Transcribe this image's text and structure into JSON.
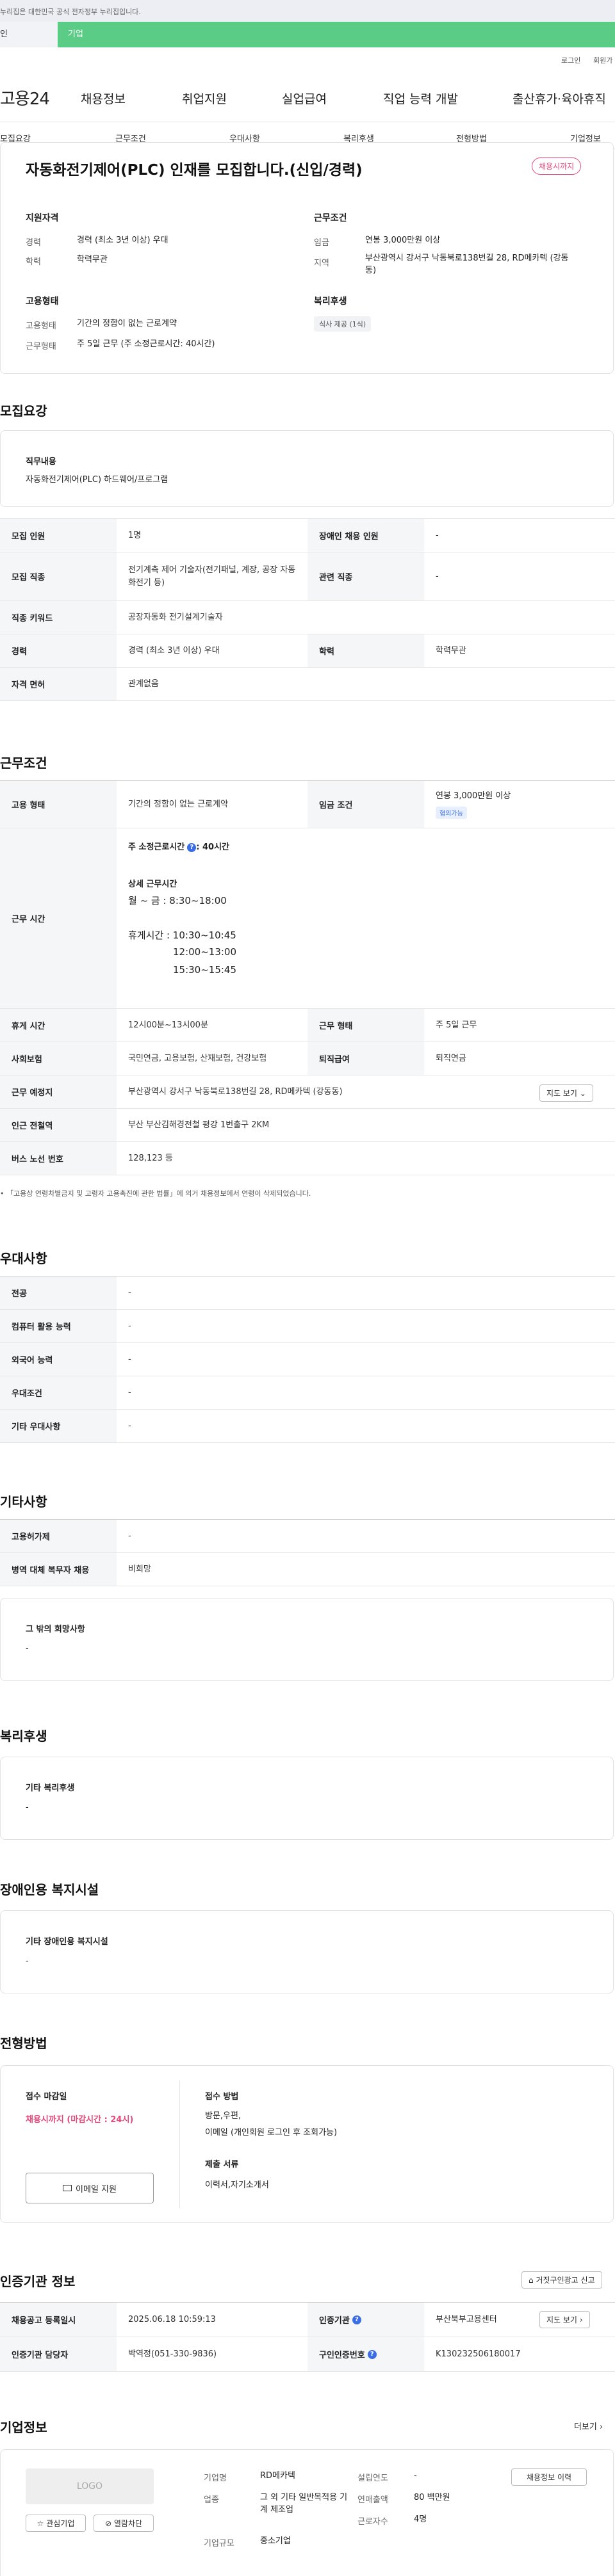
{
  "gov_notice": "누리집은 대한민국 공식 전자정부 누리집입니다.",
  "top_tabs": {
    "left": "인",
    "right": "기업"
  },
  "util": {
    "login": "로그인",
    "join": "회원가"
  },
  "logo": "고용24",
  "gnb": [
    "채용정보",
    "취업지원",
    "실업급여",
    "직업 능력 개발",
    "출산휴가·육아휴직"
  ],
  "subnav": [
    "모집요강",
    "근무조건",
    "우대사항",
    "복리후생",
    "전형방법",
    "기업정보"
  ],
  "summary": {
    "title": "자동화전기제어(PLC) 인재를 모집합니다.(신입/경력)",
    "badge": "채용시까지",
    "qual_title": "지원자격",
    "cond_title": "근무조건",
    "career_k": "경력",
    "career_v": "경력 (최소 3년 이상) 우대",
    "edu_k": "학력",
    "edu_v": "학력무관",
    "wage_k": "임금",
    "wage_v": "연봉 3,000만원 이상",
    "area_k": "지역",
    "area_v": "부산광역시 강서구 낙동북로138번길 28, RD메카텍 (강동동)",
    "emp_title": "고용형태",
    "welfare_title": "복리후생",
    "emptype_k": "고용형태",
    "emptype_v": "기간의 정함이 없는 근로계약",
    "worktype_k": "근무형태",
    "worktype_v": "주 5일 근무 (주 소정근로시간: 40시간)",
    "welfare_tag": "식사 제공 (1식)"
  },
  "recruit": {
    "title": "모집요강",
    "duty_label": "직무내용",
    "duty_text": "자동화전기제어(PLC) 하드웨어/프로그램",
    "rows": [
      {
        "k1": "모집 인원",
        "v1": "1명",
        "k2": "장애인 채용 인원",
        "v2": "-"
      },
      {
        "k1": "모집 직종",
        "v1": "전기계측 제어 기술자(전기패널, 계장, 공장 자동화전기 등)",
        "k2": "관련 직종",
        "v2": "-"
      },
      {
        "k1": "직종 키워드",
        "v1": "공장자동화 전기설계기술자"
      },
      {
        "k1": "경력",
        "v1": "경력 (최소 3년 이상) 우대",
        "k2": "학력",
        "v2": "학력무관"
      },
      {
        "k1": "자격 면허",
        "v1": "관계없음"
      }
    ]
  },
  "work": {
    "title": "근무조건",
    "emptype_k": "고용 형태",
    "emptype_v": "기간의 정함이 없는 근로계약",
    "wage_k": "임금 조건",
    "wage_v": "연봉 3,000만원 이상",
    "wage_tag": "협의가능",
    "time_k": "근무 시간",
    "weekly": "주 소정근로시간",
    "weekly_v": ": 40시간",
    "detail_title": "상세 근무시간",
    "detail_line": "월 ~ 금 : 8:30~18:00",
    "break_1": "휴게시간 : 10:30~10:45",
    "break_2": "12:00~13:00",
    "break_3": "15:30~15:45",
    "rest_k": "휴게 시간",
    "rest_v": "12시00분~13시00분",
    "form_k": "근무 형태",
    "form_v": "주 5일 근무",
    "ins_k": "사회보험",
    "ins_v": "국민연금, 고용보험, 산재보험, 건강보험",
    "ret_k": "퇴직급여",
    "ret_v": "퇴직연금",
    "place_k": "근무 예정지",
    "place_v": "부산광역시 강서구 낙동북로138번길 28, RD메카텍 (강동동)",
    "map_btn": "지도 보기",
    "subway_k": "인근 전철역",
    "subway_v": "부산 부산김해경전철 평강 1번출구 2KM",
    "bus_k": "버스 노선 번호",
    "bus_v": "128,123 등",
    "note": "「고용상 연령차별금지 및 고령자 고용촉진에 관한 법률」에 의거 채용정보에서 연령이 삭제되었습니다."
  },
  "pref": {
    "title": "우대사항",
    "rows": [
      {
        "k": "전공",
        "v": "-"
      },
      {
        "k": "컴퓨터 활용 능력",
        "v": "-"
      },
      {
        "k": "외국어 능력",
        "v": "-"
      },
      {
        "k": "우대조건",
        "v": "-"
      },
      {
        "k": "기타 우대사항",
        "v": "-"
      }
    ]
  },
  "etc": {
    "title": "기타사항",
    "rows": [
      {
        "k": "고용허가제",
        "v": "-"
      },
      {
        "k": "병역 대체 복무자 채용",
        "v": "비희망"
      }
    ],
    "hope_title": "그 밖의 희망사항",
    "hope_v": "-"
  },
  "welfare": {
    "title": "복리후생",
    "sub": "기타 복리후생",
    "v": "-"
  },
  "disabled": {
    "title": "장애인용 복지시설",
    "sub": "기타 장애인용 복지시설",
    "v": "-"
  },
  "method": {
    "title": "전형방법",
    "deadline_k": "접수 마감일",
    "deadline_v": "채용시까지 (마감시간 : 24시)",
    "apply_btn": "이메일 지원",
    "how_k": "접수 방법",
    "how_v1": "방문,우편,",
    "how_v2": "이메일 (개인회원 로그인 후 조회가능)",
    "docs_k": "제출 서류",
    "docs_v": "이력서,자기소개서"
  },
  "cert": {
    "title": "인증기관 정보",
    "report_btn": "거짓구인광고 신고",
    "reg_k": "채용공고 등록일시",
    "reg_v": "2025.06.18 10:59:13",
    "org_k": "인증기관",
    "org_v": "부산북부고용센터",
    "map_btn": "지도 보기",
    "mgr_k": "인증기관 담당자",
    "mgr_v": "박역정(051-330-9836)",
    "no_k": "구인인증번호",
    "no_v": "K130232506180017"
  },
  "company": {
    "title": "기업정보",
    "more": "더보기",
    "logo": "LOGO",
    "fav_btn": "관심기업",
    "block_btn": "열람차단",
    "name_k": "기업명",
    "name_v": "RD메카텍",
    "biz_k": "업종",
    "biz_v": "그 외 기타 일반목적용 기계 제조업",
    "size_k": "기업규모",
    "size_v": "중소기업",
    "year_k": "설립연도",
    "year_v": "-",
    "sales_k": "연매출액",
    "sales_v": "80 백만원",
    "emp_k": "근로자수",
    "emp_v": "4명",
    "history_btn": "채용정보 이력"
  }
}
